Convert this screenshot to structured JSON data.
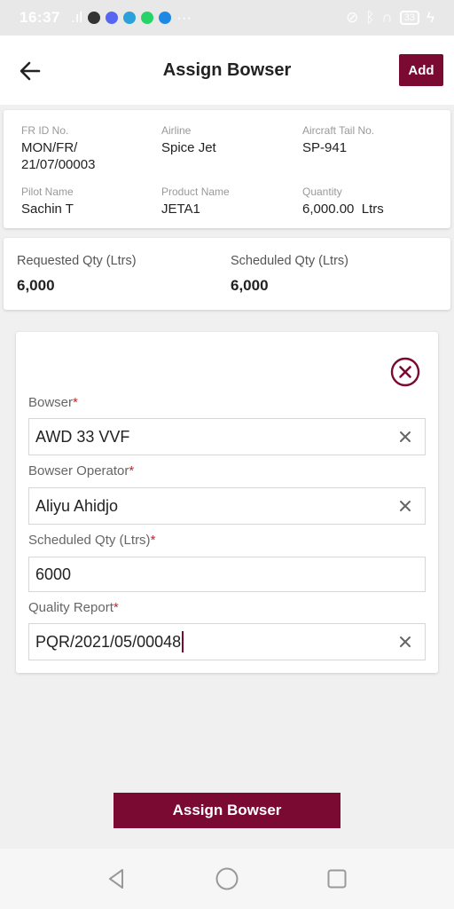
{
  "status_bar": {
    "time": "16:37",
    "signal": ".ıl",
    "battery": "33",
    "icons": [
      "signal-icon",
      "vi-app-icon",
      "discord-icon",
      "telegram-icon",
      "whatsapp-icon",
      "play-icon",
      "more-dots-icon",
      "mute-icon",
      "bluetooth-icon",
      "headphones-icon",
      "battery-icon",
      "charging-icon"
    ]
  },
  "header": {
    "title": "Assign Bowser",
    "add_label": "Add"
  },
  "info": {
    "fr_id_label": "FR ID No.",
    "fr_id_value": "MON/FR/\n21/07/00003",
    "airline_label": "Airline",
    "airline_value": "Spice Jet",
    "tail_label": "Aircraft Tail No.",
    "tail_value": "SP-941",
    "pilot_label": "Pilot Name",
    "pilot_value": "Sachin T",
    "product_label": "Product Name",
    "product_value": "JETA1",
    "quantity_label": "Quantity",
    "quantity_value": "6,000.00  Ltrs"
  },
  "qty": {
    "requested_label": "Requested Qty (Ltrs)",
    "requested_value": "6,000",
    "scheduled_label": "Scheduled Qty (Ltrs)",
    "scheduled_value": "6,000"
  },
  "form": {
    "required_mark": "*",
    "bowser_label": "Bowser",
    "bowser_value": "AWD 33 VVF",
    "operator_label": "Bowser Operator",
    "operator_value": "Aliyu Ahidjo",
    "sched_label": "Scheduled Qty (Ltrs)",
    "sched_value": "6000",
    "quality_label": "Quality Report",
    "quality_value": "PQR/2021/05/00048"
  },
  "footer": {
    "assign_label": "Assign Bowser"
  },
  "colors": {
    "accent": "#7a0a32",
    "required": "#c0282f"
  }
}
